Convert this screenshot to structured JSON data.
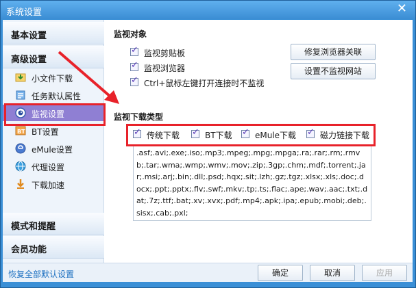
{
  "window": {
    "title": "系统设置",
    "close_glyph": "✕"
  },
  "sidebar": {
    "basic": "基本设置",
    "advanced": "高级设置",
    "items": [
      {
        "label": "小文件下载",
        "icon": "download-small-icon"
      },
      {
        "label": "任务默认属性",
        "icon": "task-icon"
      },
      {
        "label": "监视设置",
        "icon": "monitor-eye-icon",
        "active": true
      },
      {
        "label": "BT设置",
        "icon": "bt-icon"
      },
      {
        "label": "eMule设置",
        "icon": "emule-icon"
      },
      {
        "label": "代理设置",
        "icon": "proxy-globe-icon"
      },
      {
        "label": "下载加速",
        "icon": "accelerate-icon"
      }
    ],
    "mode": "模式和提醒",
    "member": "会员功能"
  },
  "monitor_objects": {
    "title": "监视对象",
    "checks": [
      {
        "label": "监视剪贴板",
        "checked": true
      },
      {
        "label": "监视浏览器",
        "checked": true
      },
      {
        "label": "Ctrl+鼠标左键打开连接时不监视",
        "checked": true
      }
    ],
    "repair_button": "修复浏览器关联",
    "no_monitor_button": "设置不监视网站"
  },
  "download_types": {
    "title": "监视下载类型",
    "checks": [
      {
        "label": "传统下载",
        "checked": true
      },
      {
        "label": "BT下载",
        "checked": true
      },
      {
        "label": "eMule下载",
        "checked": true
      },
      {
        "label": "磁力链接下载",
        "checked": true
      }
    ],
    "extensions": ".asf;.avi;.exe;.iso;.mp3;.mpeg;.mpg;.mpga;.ra;.rar;.rm;.rmvb;.tar;.wma;.wmp;.wmv;.mov;.zip;.3gp;.chm;.mdf;.torrent;.jar;.msi;.arj;.bin;.dll;.psd;.hqx;.sit;.lzh;.gz;.tgz;.xlsx;.xls;.doc;.docx;.ppt;.pptx;.flv;.swf;.mkv;.tp;.ts;.flac;.ape;.wav;.aac;.txt;.dat;.7z;.ttf;.bat;.xv;.xvx;.pdf;.mp4;.apk;.ipa;.epub;.mobi;.deb;.sisx;.cab;.pxl;"
  },
  "footer": {
    "restore_defaults": "恢复全部默认设置",
    "ok": "确定",
    "cancel": "取消",
    "apply": "应用"
  },
  "colors": {
    "accent": "#8f7fd3",
    "highlight": "#e8222a",
    "titlebar": "#3b8dd4"
  }
}
